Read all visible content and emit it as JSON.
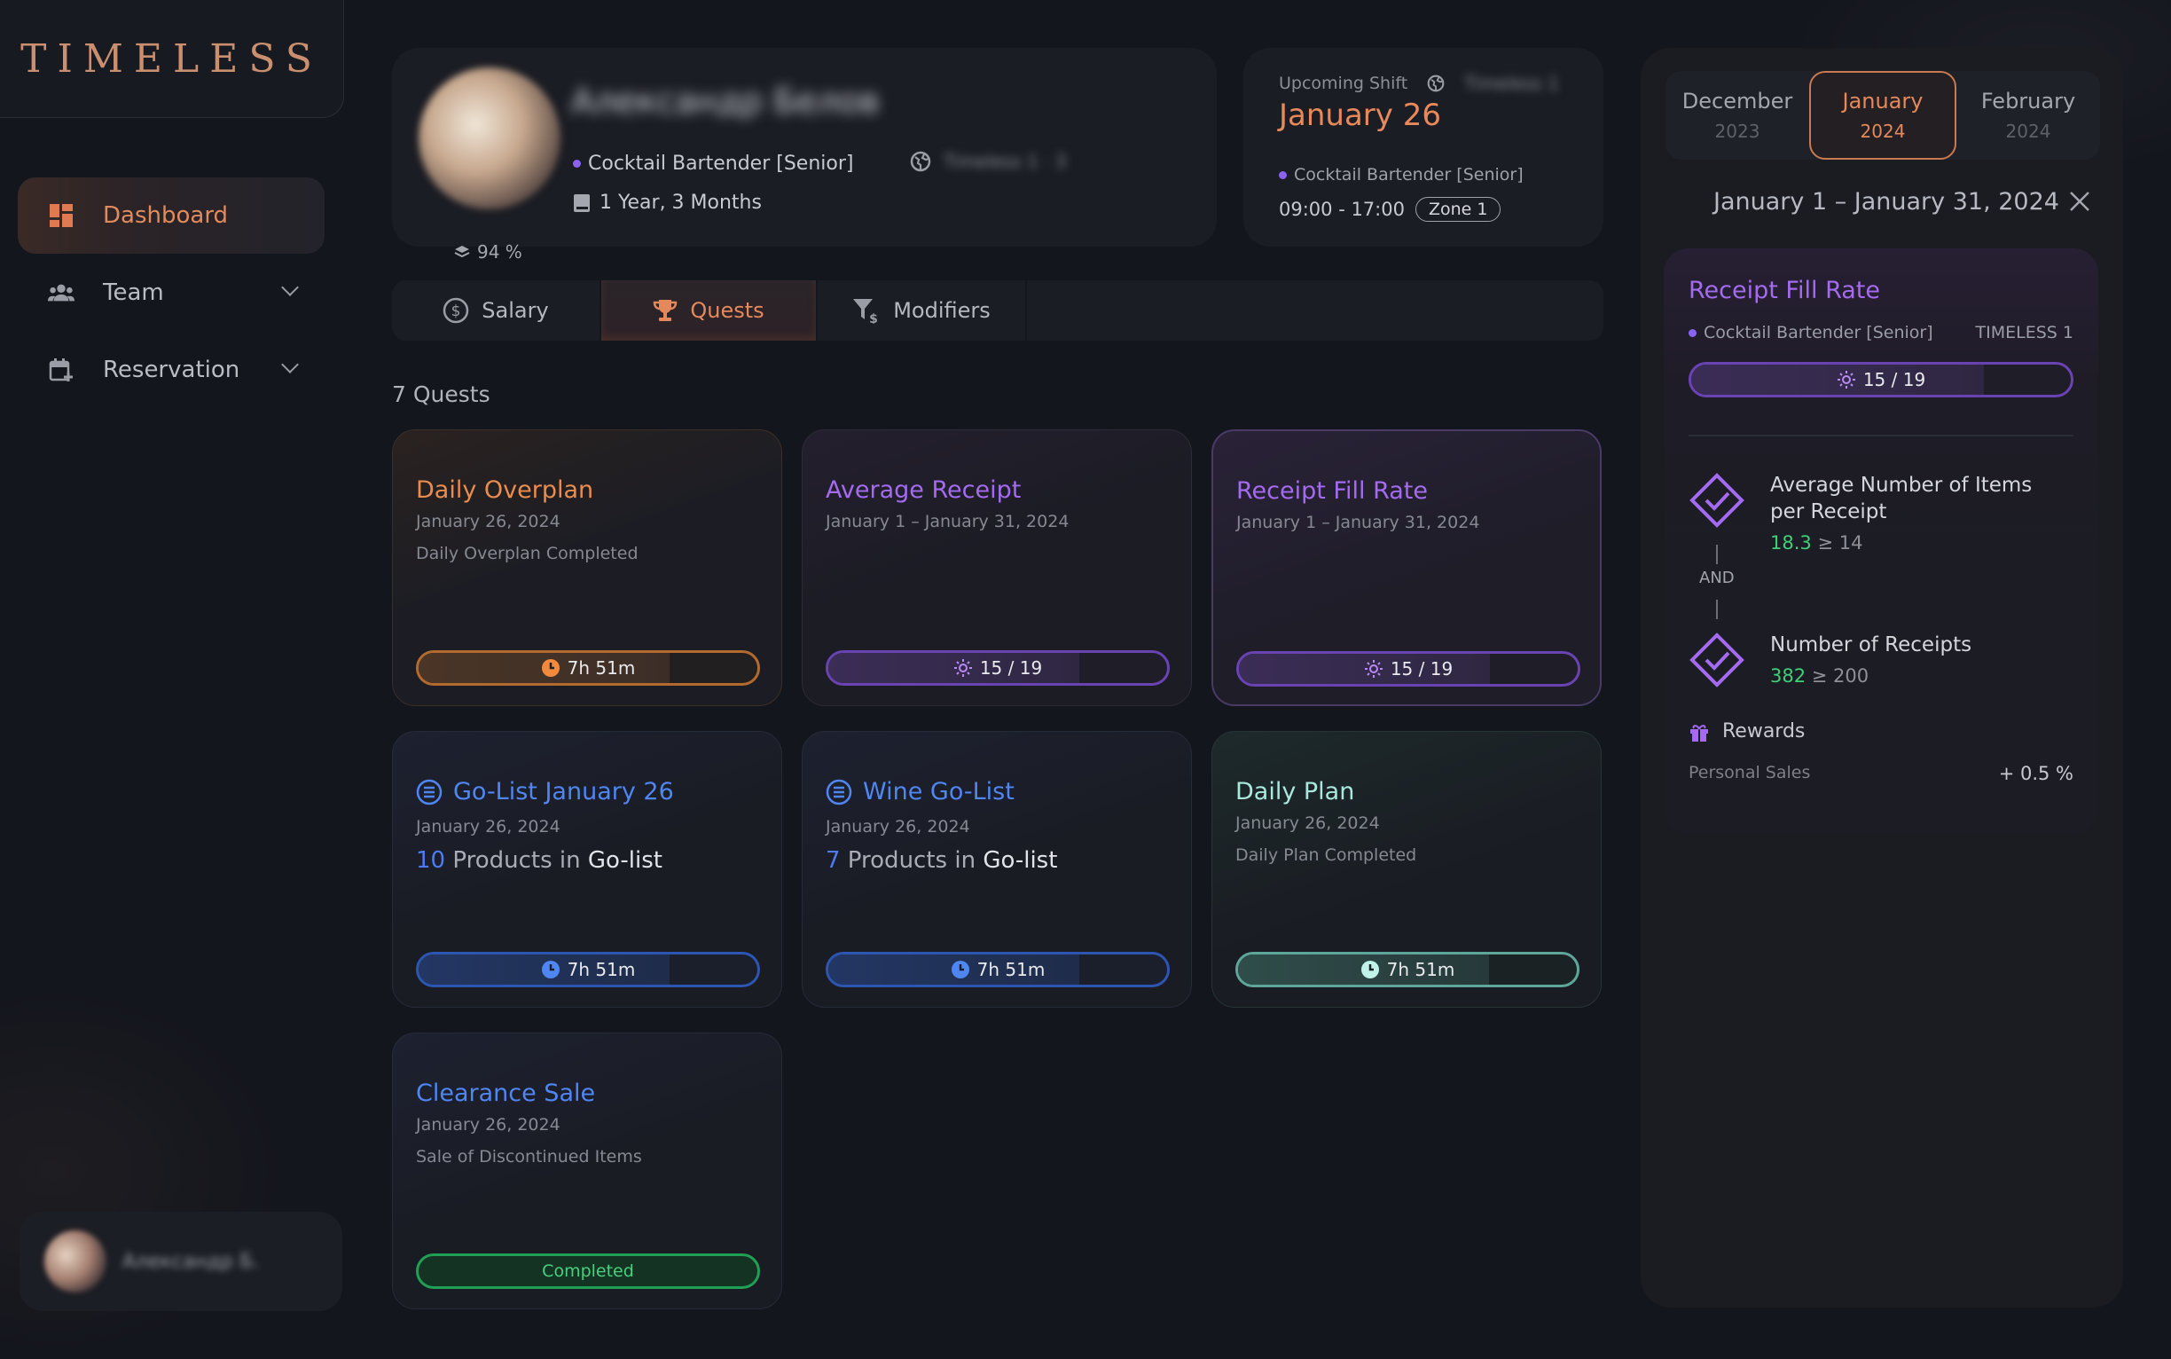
{
  "app": {
    "logo": "TIMELESS"
  },
  "sidebar": {
    "items": [
      {
        "label": "Dashboard",
        "icon": "dashboard-icon",
        "active": true
      },
      {
        "label": "Team",
        "icon": "team-icon",
        "expandable": true
      },
      {
        "label": "Reservation",
        "icon": "calendar-add-icon",
        "expandable": true
      }
    ],
    "user": {
      "name": "Александр Б."
    }
  },
  "profile": {
    "name": "Александр Белов",
    "percent": "94 %",
    "role": "Cocktail Bartender [Senior]",
    "location": "Timeless 1 · 3",
    "tenure": "1 Year, 3 Months"
  },
  "shift": {
    "label": "Upcoming Shift",
    "location": "Timeless 1",
    "date": "January 26",
    "role": "Cocktail Bartender [Senior]",
    "time": "09:00 - 17:00",
    "zone": "Zone 1"
  },
  "tabs": [
    {
      "label": "Salary",
      "icon": "dollar-icon"
    },
    {
      "label": "Quests",
      "icon": "trophy-icon",
      "active": true
    },
    {
      "label": "Modifiers",
      "icon": "filter-dollar-icon"
    }
  ],
  "quests": {
    "count_label": "7 Quests",
    "items": [
      {
        "title": "Daily Overplan",
        "date": "January 26, 2024",
        "desc": "Daily Overplan Completed",
        "bar_label": "7h 51m",
        "progress": 0.74,
        "theme": "orange"
      },
      {
        "title": "Average Receipt",
        "date": "January 1 – January 31, 2024",
        "bar_label": "15 / 19",
        "progress": 0.74,
        "theme": "purple"
      },
      {
        "title": "Receipt Fill Rate",
        "date": "January 1 – January 31, 2024",
        "bar_label": "15 / 19",
        "progress": 0.74,
        "theme": "purple",
        "selected": true
      },
      {
        "title": "Go-List January 26",
        "date": "January 26, 2024",
        "golist_num": "10",
        "golist_mid": " Products in ",
        "golist_end": "Go-list",
        "bar_label": "7h 51m",
        "progress": 0.74,
        "theme": "blue"
      },
      {
        "title": "Wine Go-List",
        "date": "January 26, 2024",
        "golist_num": "7",
        "golist_mid": " Products in ",
        "golist_end": "Go-list",
        "bar_label": "7h 51m",
        "progress": 0.74,
        "theme": "blue"
      },
      {
        "title": "Daily Plan",
        "date": "January 26, 2024",
        "desc": "Daily Plan Completed",
        "bar_label": "7h 51m",
        "progress": 0.74,
        "theme": "teal"
      },
      {
        "title": "Clearance Sale",
        "date": "January 26, 2024",
        "desc": "Sale of Discontinued Items",
        "bar_label": "Completed",
        "progress": 1.0,
        "theme": "green"
      }
    ]
  },
  "detail": {
    "months": [
      {
        "month": "December",
        "year": "2023"
      },
      {
        "month": "January",
        "year": "2024",
        "active": true
      },
      {
        "month": "February",
        "year": "2024"
      }
    ],
    "range": "January 1 – January 31, 2024",
    "title": "Receipt Fill Rate",
    "role": "Cocktail Bartender [Senior]",
    "location": "TIMELESS 1",
    "bar_label": "15 / 19",
    "progress": 0.77,
    "conditions": [
      {
        "name": "Average Number of Items per Receipt",
        "value": "18.3",
        "target": " ≥ 14"
      },
      {
        "name": "Number of Receipts",
        "value": "382",
        "target": " ≥ 200"
      }
    ],
    "and_label": "AND",
    "rewards_label": "Rewards",
    "reward": {
      "name": "Personal Sales",
      "value": "+ 0.5 %"
    }
  },
  "colors": {
    "accent_orange": "#e4895c",
    "purple": "#a46bf0",
    "blue": "#4f86f2",
    "teal": "#a9e8dc",
    "green": "#46d07f"
  }
}
